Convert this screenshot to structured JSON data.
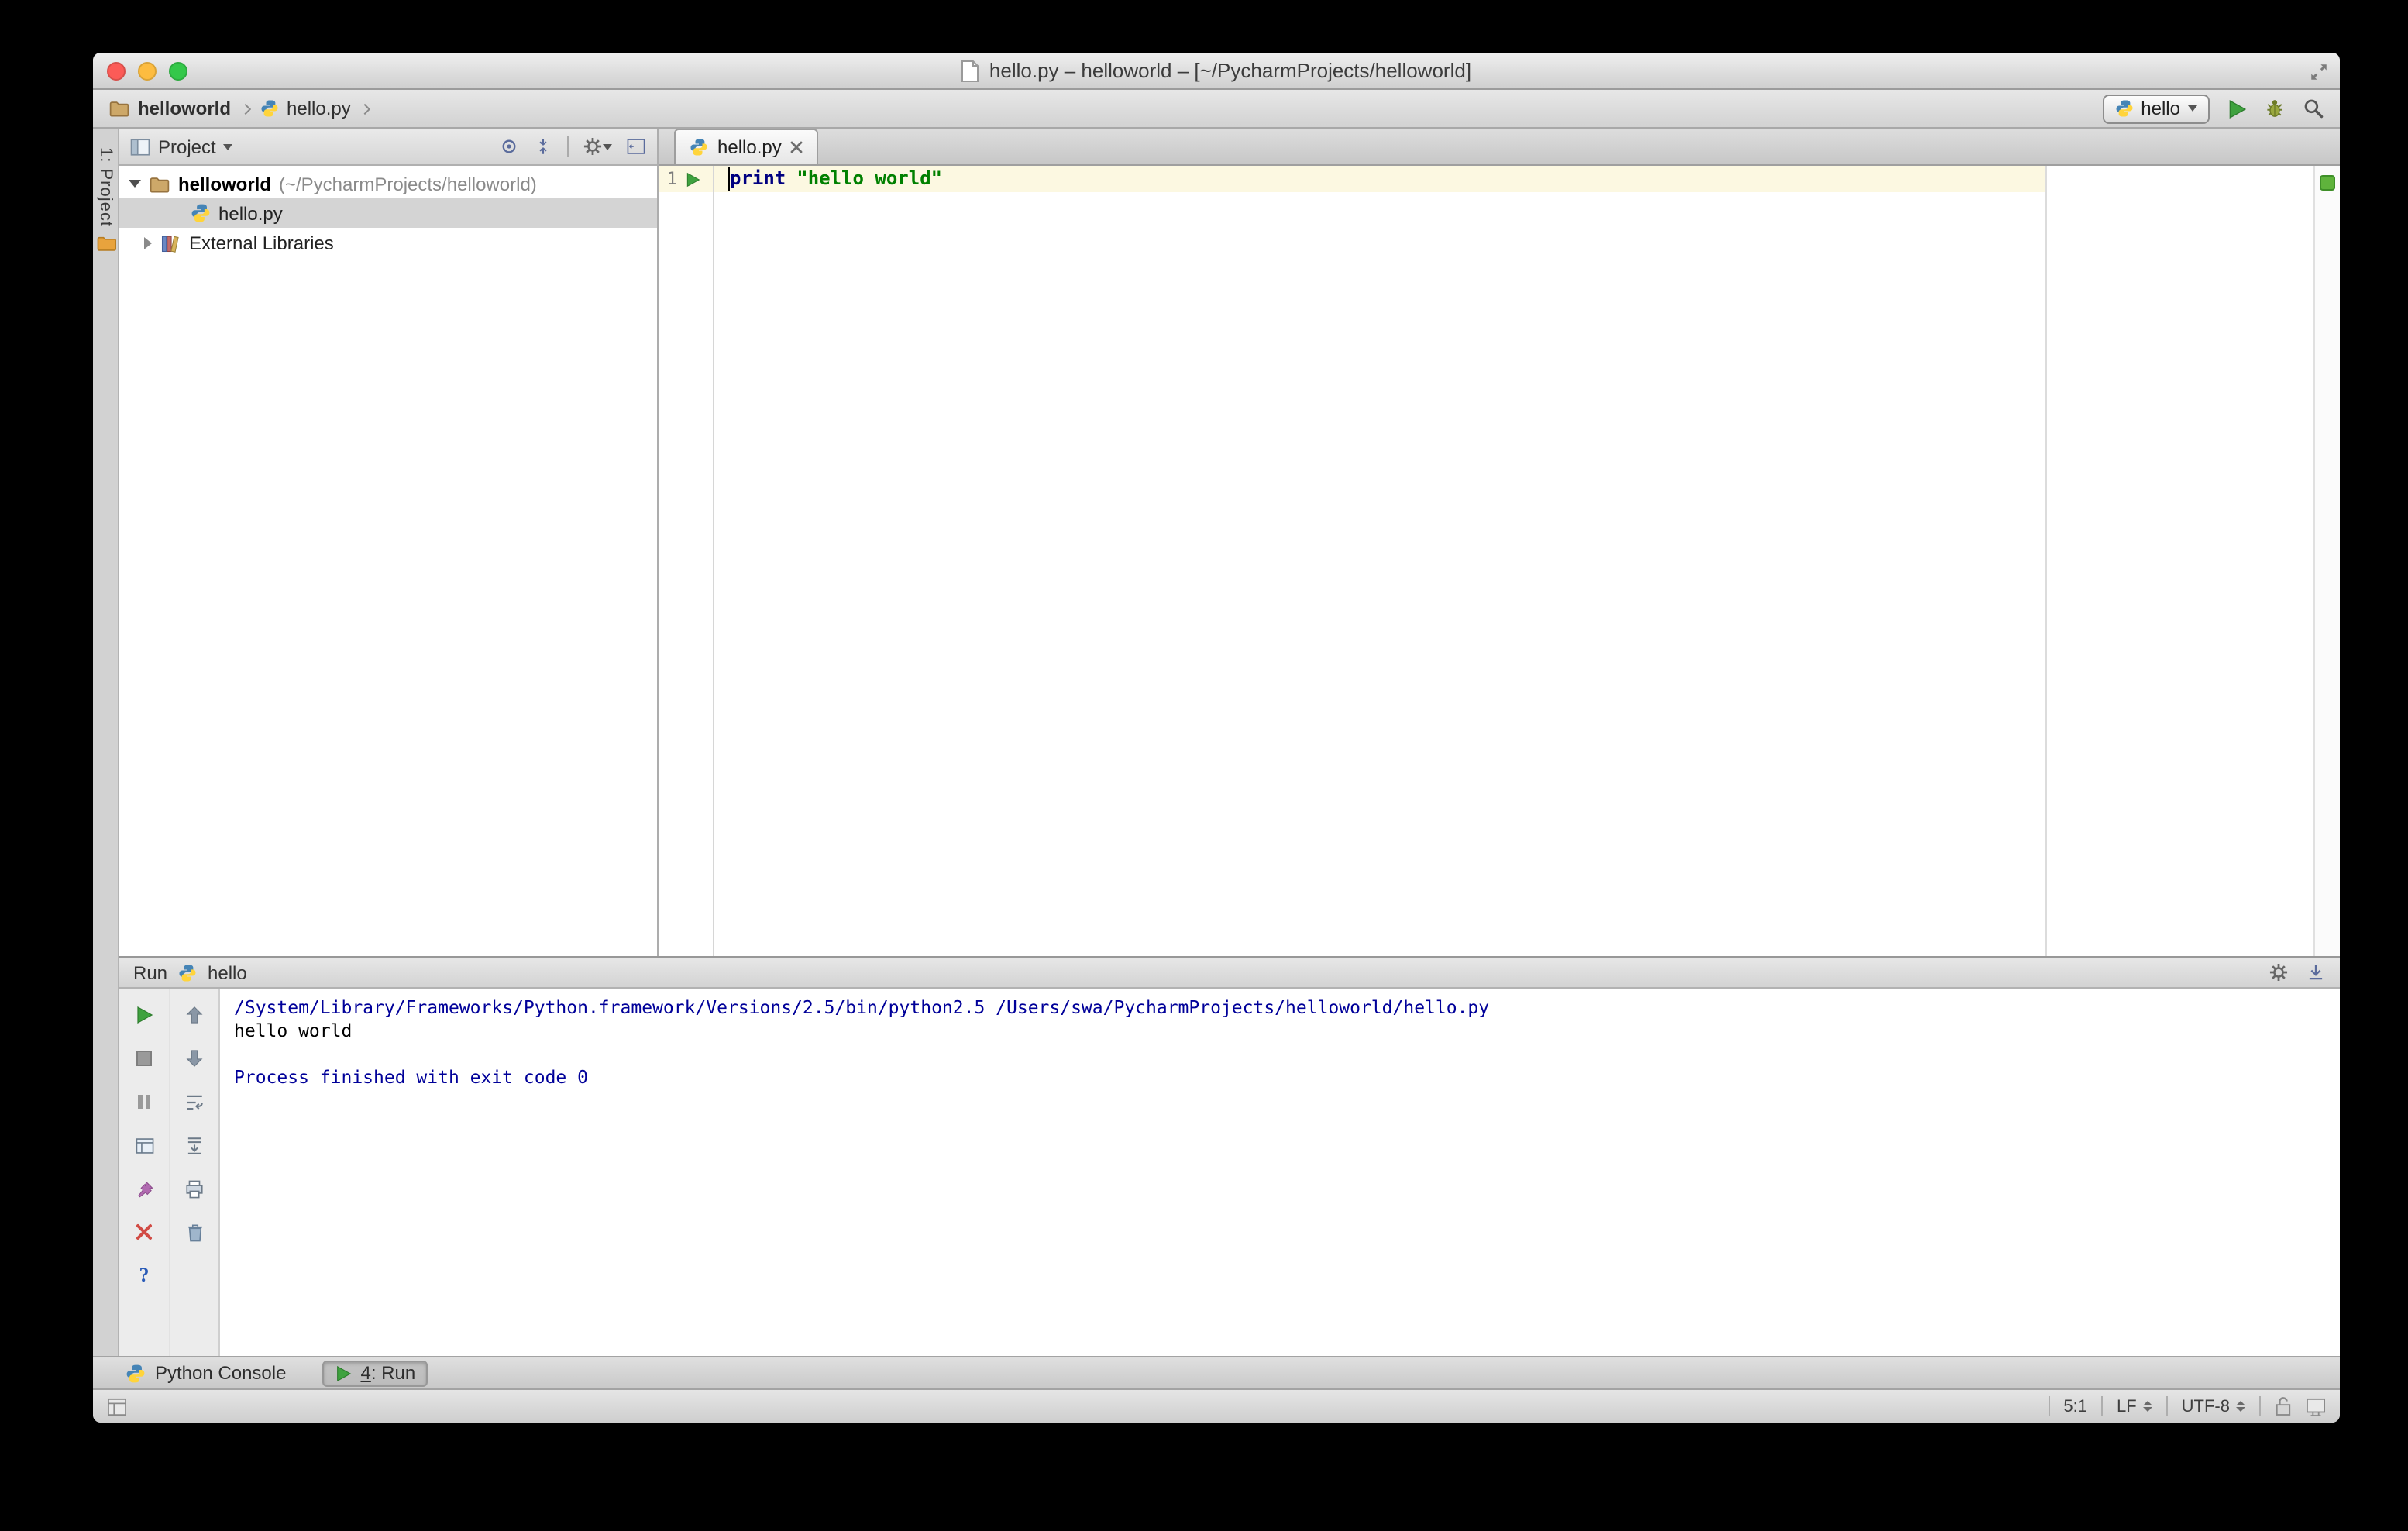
{
  "colors": {
    "keyword_blue": "#000080",
    "string_green": "#008000",
    "console_info_blue": "#000099",
    "current_line_yellow": "#fcf8e1",
    "run_green": "#3fa23f",
    "selection_gray": "#d4d4d4"
  },
  "icons": {
    "help_glyph": "?"
  },
  "titlebar": {
    "title": "hello.py – helloworld – [~/PycharmProjects/helloworld]"
  },
  "navbar": {
    "breadcrumbs": [
      {
        "label": "helloworld"
      },
      {
        "label": "hello.py"
      }
    ],
    "run_config_name": "hello"
  },
  "tool_stripe": {
    "project_button": "1: Project"
  },
  "project_panel": {
    "title": "Project",
    "root_label": "helloworld",
    "root_path": "(~/PycharmProjects/helloworld)",
    "file_label": "hello.py",
    "external_libraries_label": "External Libraries"
  },
  "editor": {
    "tab_label": "hello.py",
    "line_number": "1",
    "keyword": "print",
    "string": "\"hello world\""
  },
  "run_panel": {
    "title": "Run",
    "session_name": "hello",
    "console_lines": [
      {
        "text": "/System/Library/Frameworks/Python.framework/Versions/2.5/bin/python2.5 /Users/swa/PycharmProjects/helloworld/hello.py",
        "kind": "system"
      },
      {
        "text": "hello world",
        "kind": "stdout"
      },
      {
        "text": "",
        "kind": "blank"
      },
      {
        "text": "Process finished with exit code 0",
        "kind": "system"
      }
    ]
  },
  "bottom_bar": {
    "python_console_label": "Python Console",
    "run_tab_mnemonic": "4",
    "run_tab_label": ": Run"
  },
  "status_bar": {
    "caret_position": "5:1",
    "line_separator": "LF",
    "encoding": "UTF-8"
  }
}
